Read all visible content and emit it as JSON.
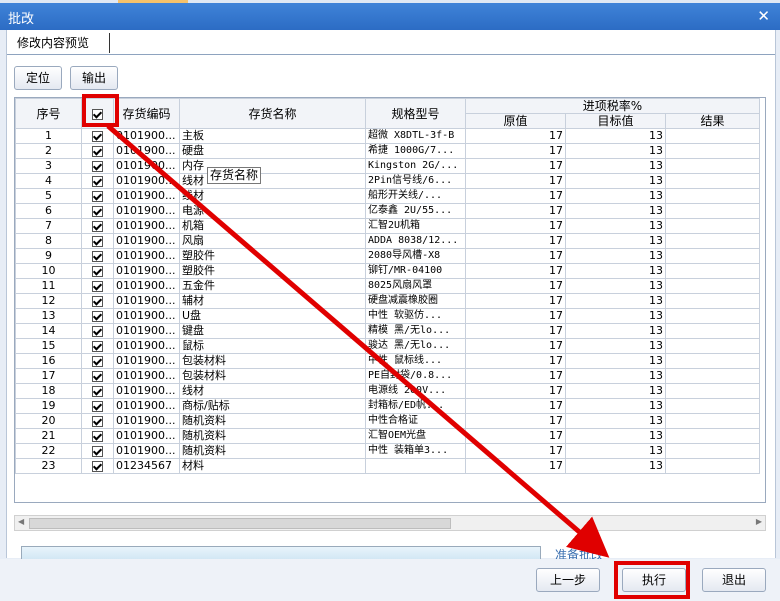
{
  "window": {
    "title": "批改",
    "close_symbol": "✕"
  },
  "tab": {
    "label": "修改内容预览"
  },
  "toolbar": {
    "locate_label": "定位",
    "export_label": "输出"
  },
  "table": {
    "headers": {
      "seq": "序号",
      "code": "存货编码",
      "name": "存货名称",
      "spec": "规格型号",
      "group": "进项税率%",
      "orig": "原值",
      "target": "目标值",
      "result": "结果"
    },
    "rows": [
      {
        "seq": "1",
        "code": "0101900...",
        "name": "主板",
        "spec": "超微 X8DTL-3f-B",
        "orig": "17",
        "target": "13",
        "result": ""
      },
      {
        "seq": "2",
        "code": "0101900...",
        "name": "硬盘",
        "spec": "希捷 1000G/7...",
        "orig": "17",
        "target": "13",
        "result": ""
      },
      {
        "seq": "3",
        "code": "0101900...",
        "name": "内存",
        "spec": "Kingston 2G/...",
        "orig": "17",
        "target": "13",
        "result": ""
      },
      {
        "seq": "4",
        "code": "0101900...",
        "name": "线材",
        "spec": "2Pin信号线/6...",
        "orig": "17",
        "target": "13",
        "result": ""
      },
      {
        "seq": "5",
        "code": "0101900...",
        "name": "线材",
        "spec": "船形开关线/...",
        "orig": "17",
        "target": "13",
        "result": ""
      },
      {
        "seq": "6",
        "code": "0101900...",
        "name": "电源",
        "spec": "亿泰鑫 2U/55...",
        "orig": "17",
        "target": "13",
        "result": ""
      },
      {
        "seq": "7",
        "code": "0101900...",
        "name": "机箱",
        "spec": "汇智2U机箱",
        "orig": "17",
        "target": "13",
        "result": ""
      },
      {
        "seq": "8",
        "code": "0101900...",
        "name": "风扇",
        "spec": "ADDA 8038/12...",
        "orig": "17",
        "target": "13",
        "result": ""
      },
      {
        "seq": "9",
        "code": "0101900...",
        "name": "塑胶件",
        "spec": "2080导风槽-X8",
        "orig": "17",
        "target": "13",
        "result": ""
      },
      {
        "seq": "10",
        "code": "0101900...",
        "name": "塑胶件",
        "spec": "铆钉/MR-04100",
        "orig": "17",
        "target": "13",
        "result": ""
      },
      {
        "seq": "11",
        "code": "0101900...",
        "name": "五金件",
        "spec": "8025风扇风罩",
        "orig": "17",
        "target": "13",
        "result": ""
      },
      {
        "seq": "12",
        "code": "0101900...",
        "name": "辅材",
        "spec": "硬盘减震橡胶圈",
        "orig": "17",
        "target": "13",
        "result": ""
      },
      {
        "seq": "13",
        "code": "0101900...",
        "name": "U盘",
        "spec": "中性 软驱仿...",
        "orig": "17",
        "target": "13",
        "result": ""
      },
      {
        "seq": "14",
        "code": "0101900...",
        "name": "键盘",
        "spec": "精模 黑/无lo...",
        "orig": "17",
        "target": "13",
        "result": ""
      },
      {
        "seq": "15",
        "code": "0101900...",
        "name": "鼠标",
        "spec": "骏达 黑/无lo...",
        "orig": "17",
        "target": "13",
        "result": ""
      },
      {
        "seq": "16",
        "code": "0101900...",
        "name": "包装材料",
        "spec": "中性 鼠标线...",
        "orig": "17",
        "target": "13",
        "result": ""
      },
      {
        "seq": "17",
        "code": "0101900...",
        "name": "包装材料",
        "spec": "PE自封袋/0.8...",
        "orig": "17",
        "target": "13",
        "result": ""
      },
      {
        "seq": "18",
        "code": "0101900...",
        "name": "线材",
        "spec": "电源线 200V...",
        "orig": "17",
        "target": "13",
        "result": ""
      },
      {
        "seq": "19",
        "code": "0101900...",
        "name": "商标/贴标",
        "spec": "封箱标/ED帆...",
        "orig": "17",
        "target": "13",
        "result": ""
      },
      {
        "seq": "20",
        "code": "0101900...",
        "name": "随机资料",
        "spec": "中性合格证",
        "orig": "17",
        "target": "13",
        "result": ""
      },
      {
        "seq": "21",
        "code": "0101900...",
        "name": "随机资料",
        "spec": "汇智OEM光盘",
        "orig": "17",
        "target": "13",
        "result": ""
      },
      {
        "seq": "22",
        "code": "0101900...",
        "name": "随机资料",
        "spec": "中性 装箱单3...",
        "orig": "17",
        "target": "13",
        "result": ""
      },
      {
        "seq": "23",
        "code": "01234567",
        "name": "材料",
        "spec": "",
        "orig": "17",
        "target": "13",
        "result": ""
      }
    ]
  },
  "tooltip": {
    "text": "存货名称"
  },
  "status": {
    "text": "准备批改"
  },
  "footer": {
    "prev_label": "上一步",
    "execute_label": "执行",
    "exit_label": "退出"
  },
  "colors": {
    "titlebar": "#2c6cc4",
    "highlight": "#e00000",
    "status": "#3a6fb0"
  },
  "icons": {
    "checkbox": "check-icon",
    "close": "close-icon"
  }
}
